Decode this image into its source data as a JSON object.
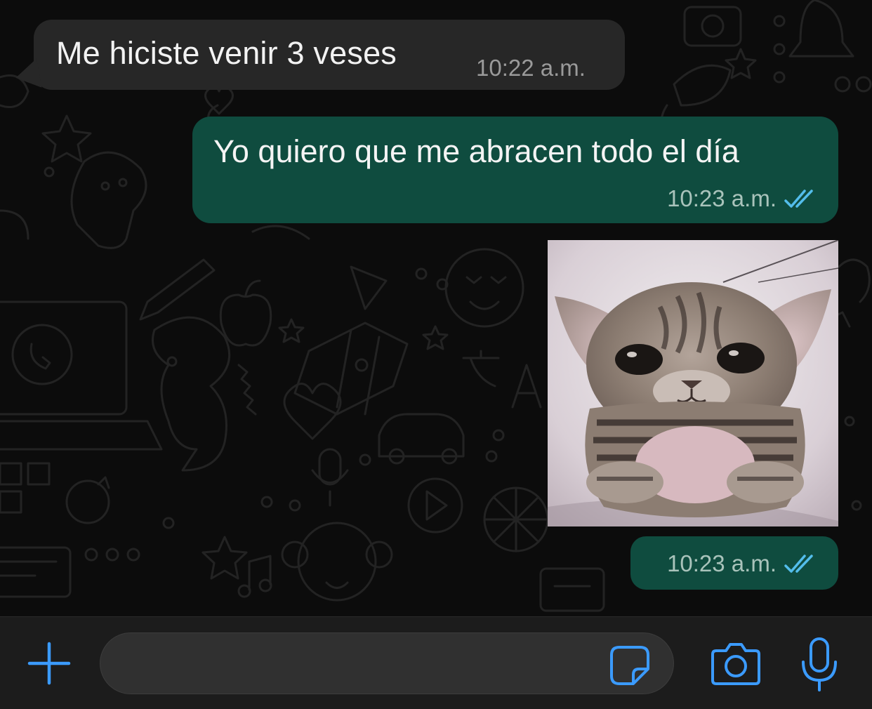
{
  "messages": [
    {
      "direction": "incoming",
      "text": "Me hiciste venir 3 veses",
      "time": "10:22 a.m."
    },
    {
      "direction": "outgoing",
      "text": "Yo quiero que me abracen todo el día",
      "time": "10:23 a.m.",
      "status": "read"
    },
    {
      "direction": "outgoing",
      "type": "image",
      "time": "10:23 a.m.",
      "status": "read"
    }
  ],
  "input": {
    "placeholder": "",
    "value": ""
  },
  "icons": {
    "attach": "plus-icon",
    "sticker": "sticker-icon",
    "camera": "camera-icon",
    "mic": "microphone-icon",
    "read_receipt": "double-check-icon"
  },
  "colors": {
    "incoming_bubble": "#272727",
    "outgoing_bubble": "#0f4c3f",
    "read_tick": "#53bdeb",
    "accent_blue": "#3b9bff"
  }
}
